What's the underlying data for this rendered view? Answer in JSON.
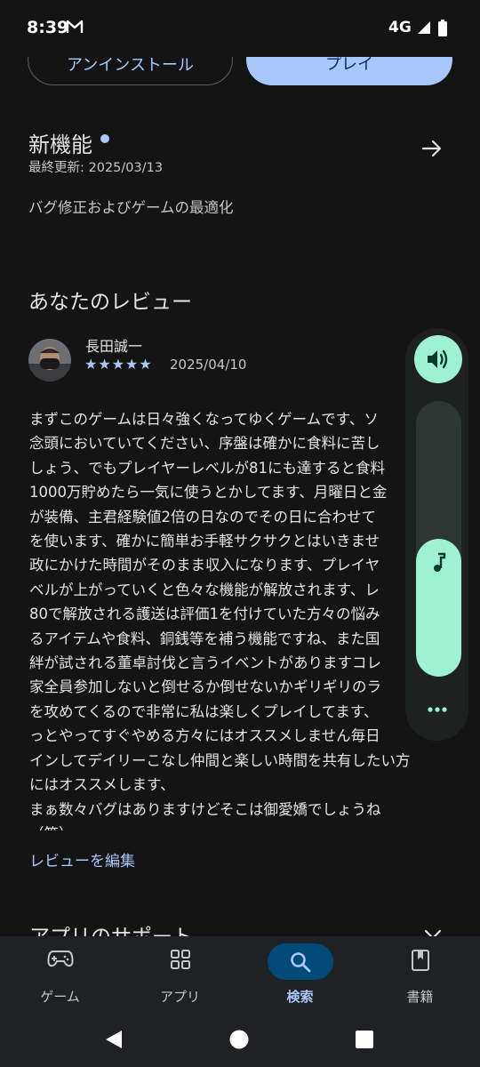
{
  "status": {
    "time": "8:39",
    "network": "4G"
  },
  "actions": {
    "uninstall": "アンインストール",
    "play": "プレイ"
  },
  "whats_new": {
    "title": "新機能",
    "updated": "最終更新: 2025/03/13",
    "body": "バグ修正およびゲームの最適化"
  },
  "review": {
    "heading": "あなたのレビュー",
    "reviewer": "長田誠一",
    "stars": "★★★★★",
    "rating": 5,
    "date": "2025/04/10",
    "lines": [
      "まずこのゲームは日々強くなってゆくゲームです、ソ",
      "念頭においていてください、序盤は確かに食料に苦し",
      "しょう、でもプレイヤーレベルが81にも達すると食料",
      "1000万貯めたら一気に使うとかしてます、月曜日と金",
      "が装備、主君経験値2倍の日なのでその日に合わせて",
      "を使います、確かに簡単お手軽サクサクとはいきませ",
      "政にかけた時間がそのまま収入になります、プレイヤ",
      "ベルが上がっていくと色々な機能が解放されます、レ",
      "80で解放される護送は評価1を付けていた方々の悩み",
      "るアイテムや食料、銅銭等を補う機能ですね、また国",
      "絆が試される董卓討伐と言うイベントがありますコレ",
      "家全員参加しないと倒せるか倒せないかギリギリのラ",
      "を攻めてくるので非常に私は楽しくプレイしてます、",
      "っとやってすぐやめる方々にはオススメしません毎日",
      "インしてデイリーこなし仲間と楽しい時間を共有したい方",
      "にはオススメします、",
      "まぁ数々バグはありますけどそこは御愛嬌でしょうね",
      "（笑）"
    ],
    "edit": "レビューを編集"
  },
  "support": {
    "title": "アプリのサポート"
  },
  "volume": {
    "level": 0.5
  },
  "nav": {
    "items": [
      {
        "label": "ゲーム",
        "icon": "gamepad-icon"
      },
      {
        "label": "アプリ",
        "icon": "apps-icon"
      },
      {
        "label": "検索",
        "icon": "search-icon"
      },
      {
        "label": "書籍",
        "icon": "book-icon"
      }
    ],
    "active": "検索"
  },
  "colors": {
    "background": "#141414",
    "accent": "#a8c7fa",
    "volume_accent": "#9ef2d3",
    "nav_background": "#202124"
  }
}
